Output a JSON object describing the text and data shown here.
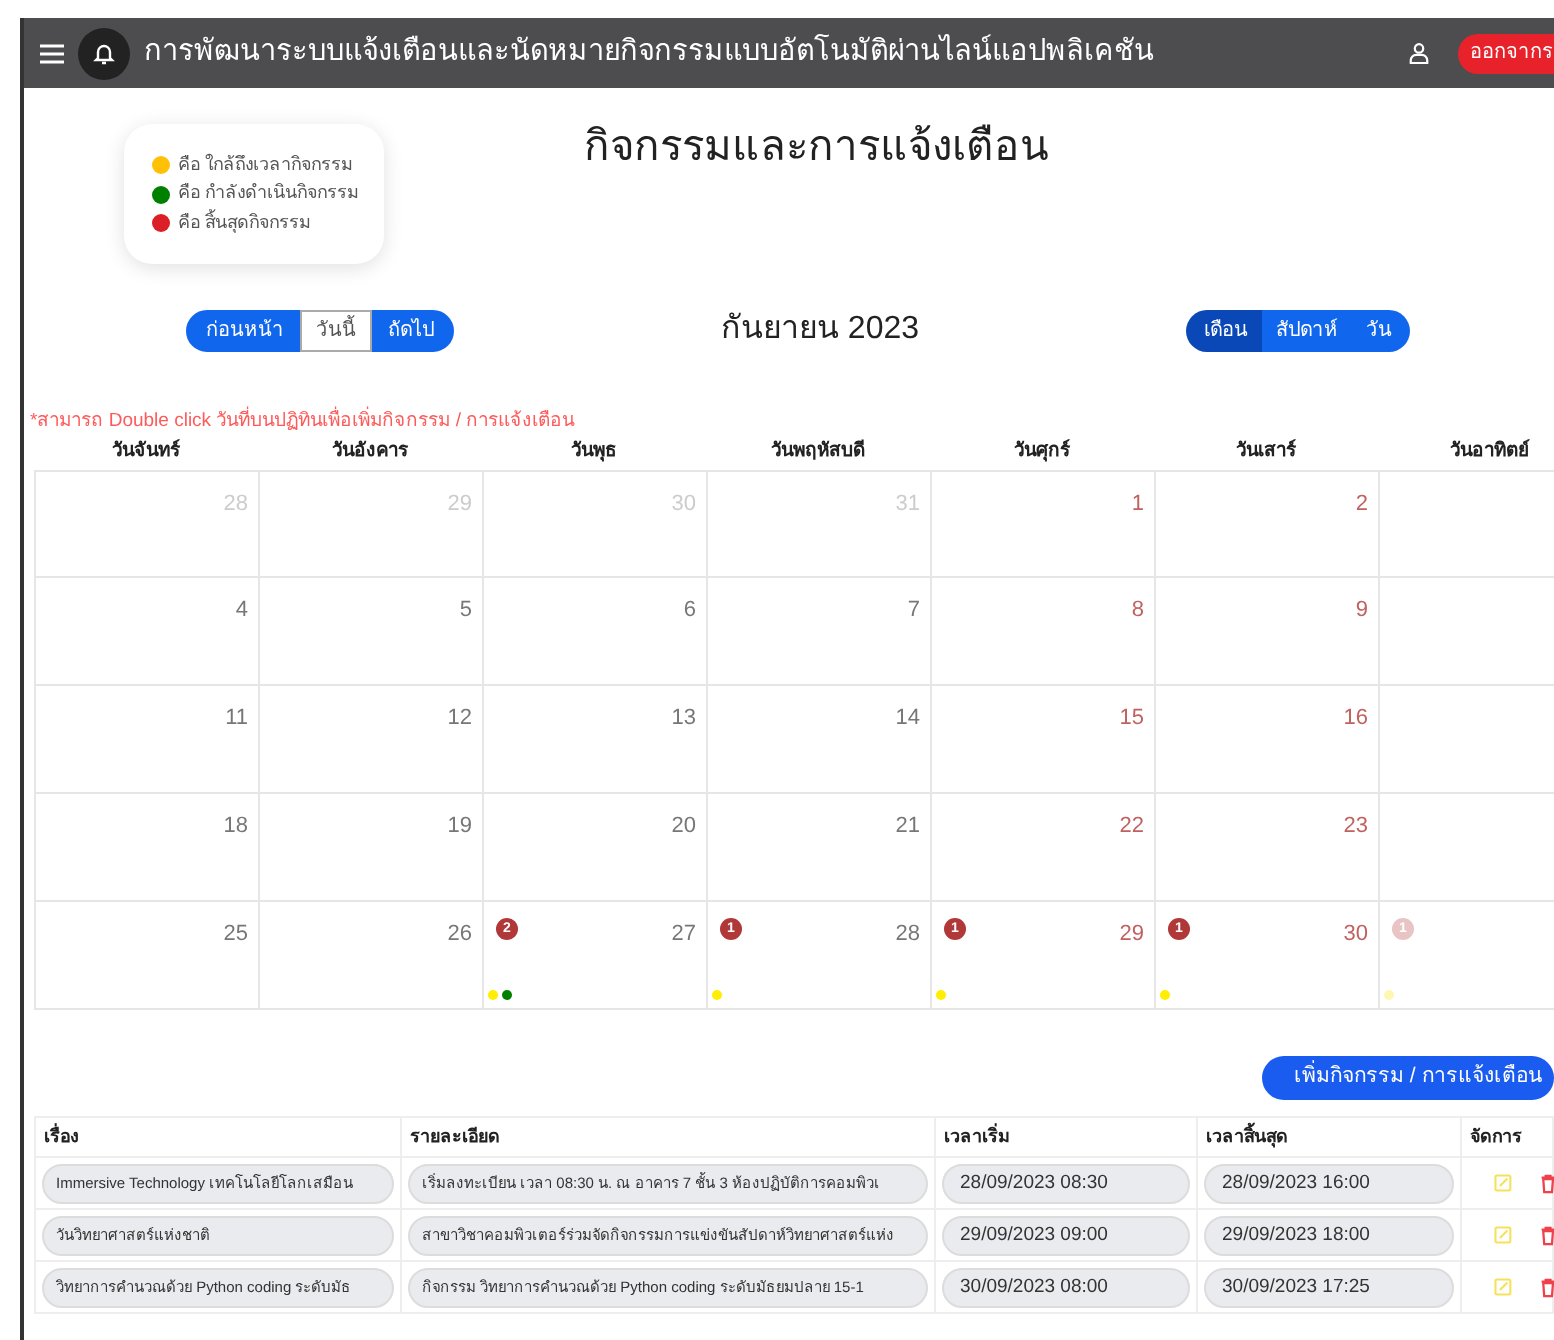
{
  "header": {
    "title": "การพัฒนาระบบแจ้งเตือนและนัดหมายกิจกรรมแบบอัตโนมัติผ่านไลน์แอปพลิเคชัน",
    "logout": "ออกจากร"
  },
  "legend": [
    {
      "color": "#ffc107",
      "label": "คือ ใกล้ถึงเวลากิจกรรม"
    },
    {
      "color": "#008000",
      "label": "คือ กำลังดำเนินกิจกรรม"
    },
    {
      "color": "#dc1f26",
      "label": "คือ สิ้นสุดกิจกรรม"
    }
  ],
  "page_title": "กิจกรรมและการแจ้งเตือน",
  "nav_buttons": [
    {
      "label": "ก่อนหน้า",
      "selected": false
    },
    {
      "label": "วันนี้",
      "selected": true
    },
    {
      "label": "ถัดไป",
      "selected": false
    }
  ],
  "month_label": "กันยายน 2023",
  "view_buttons": [
    {
      "label": "เดือน",
      "selected": true
    },
    {
      "label": "สัปดาห์",
      "selected": false
    },
    {
      "label": "วัน",
      "selected": false
    }
  ],
  "note": "*สามารถ Double click วันที่บนปฏิทินเพื่อเพิ่มกิจกรรม / การแจ้งเตือน",
  "calendar": {
    "weekdays": [
      "วันจันทร์",
      "วันอังคาร",
      "วันพุธ",
      "วันพฤหัสบดี",
      "วันศุกร์",
      "วันเสาร์",
      "วันอาทิตย์"
    ],
    "weeks": [
      [
        {
          "day": "28",
          "other_month": true
        },
        {
          "day": "29",
          "other_month": true
        },
        {
          "day": "30",
          "other_month": true
        },
        {
          "day": "31",
          "other_month": true
        },
        {
          "day": "1",
          "other_month": false,
          "marked": true
        },
        {
          "day": "2",
          "other_month": false,
          "marked": true
        }
      ],
      [
        {
          "day": "4",
          "other_month": false,
          "marked": false
        },
        {
          "day": "5",
          "other_month": false,
          "marked": false
        },
        {
          "day": "6",
          "other_month": false,
          "marked": false
        },
        {
          "day": "7",
          "other_month": false,
          "marked": false
        },
        {
          "day": "8",
          "other_month": false,
          "marked": true
        },
        {
          "day": "9",
          "other_month": false,
          "marked": true
        }
      ],
      [
        {
          "day": "11",
          "other_month": false,
          "marked": false
        },
        {
          "day": "12",
          "other_month": false,
          "marked": false
        },
        {
          "day": "13",
          "other_month": false,
          "marked": false
        },
        {
          "day": "14",
          "other_month": false,
          "marked": false
        },
        {
          "day": "15",
          "other_month": false,
          "marked": true
        },
        {
          "day": "16",
          "other_month": false,
          "marked": true
        }
      ],
      [
        {
          "day": "18",
          "other_month": false,
          "marked": false
        },
        {
          "day": "19",
          "other_month": false,
          "marked": false
        },
        {
          "day": "20",
          "other_month": false,
          "marked": false
        },
        {
          "day": "21",
          "other_month": false,
          "marked": false
        },
        {
          "day": "22",
          "other_month": false,
          "marked": true
        },
        {
          "day": "23",
          "other_month": false,
          "marked": true
        }
      ],
      [
        {
          "day": "25",
          "other_month": false,
          "marked": false
        },
        {
          "day": "26",
          "other_month": false,
          "marked": false
        },
        {
          "day": "27",
          "other_month": false,
          "marked": false,
          "badge": "2",
          "dots": [
            {
              "color": "#ffee00"
            },
            {
              "color": "#008000"
            }
          ]
        },
        {
          "day": "28",
          "other_month": false,
          "marked": false,
          "badge": "1",
          "dots": [
            {
              "color": "#ffee00"
            }
          ]
        },
        {
          "day": "29",
          "other_month": false,
          "marked": true,
          "badge": "1",
          "dots": [
            {
              "color": "#ffee00"
            }
          ]
        },
        {
          "day": "30",
          "other_month": false,
          "marked": true,
          "badge": "1",
          "dots": [
            {
              "color": "#ffee00"
            }
          ]
        },
        {
          "other_month": true,
          "badge": "1",
          "dots": [
            {
              "color": "#fff7b0"
            }
          ]
        }
      ]
    ]
  },
  "add_button": "เพิ่มกิจกรรม / การแจ้งเตือน",
  "table": {
    "columns": [
      "เรื่อง",
      "รายละเอียด",
      "เวลาเริ่ม",
      "เวลาสิ้นสุด",
      "จัดการ"
    ],
    "rows": [
      {
        "title": "Immersive Technology เทคโนโลยีโลกเสมือน",
        "detail": "เริ่มลงทะเบียน เวลา 08:30 น. ณ อาคาร 7 ชั้น 3 ห้องปฏิบัติการคอมพิวเ",
        "start": "28/09/2023 08:30",
        "end": "28/09/2023 16:00"
      },
      {
        "title": "วันวิทยาศาสตร์แห่งชาติ",
        "detail": "สาขาวิชาคอมพิวเตอร์ร่วมจัดกิจกรรมการแข่งขันสัปดาห์วิทยาศาสตร์แห่ง",
        "start": "29/09/2023 09:00",
        "end": "29/09/2023 18:00"
      },
      {
        "title": "วิทยาการคำนวณด้วย Python coding ระดับมัธ",
        "detail": "กิจกรรม วิทยาการคำนวณด้วย Python coding ระดับมัธยมปลาย 15-1",
        "start": "30/09/2023 08:00",
        "end": "30/09/2023 17:25"
      }
    ]
  }
}
